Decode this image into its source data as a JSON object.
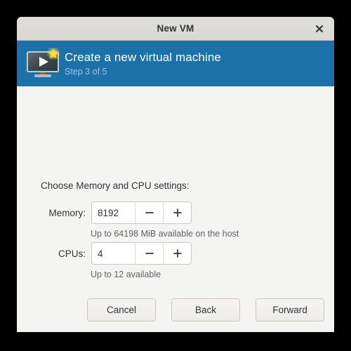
{
  "window": {
    "title": "New VM",
    "close_icon": "close-icon"
  },
  "header": {
    "icon": "new-virtual-machine-icon",
    "title": "Create a new virtual machine",
    "subtitle": "Step 3 of 5",
    "background_color": "#1c71a8",
    "title_color": "#ffffff",
    "subtitle_color": "#9dc4de"
  },
  "content": {
    "intro": "Choose Memory and CPU settings:",
    "fields": [
      {
        "label": "Memory:",
        "value": "8192",
        "decrement_icon": "minus-icon",
        "increment_icon": "plus-icon",
        "helper": "Up to 64198 MiB available on the host"
      },
      {
        "label": "CPUs:",
        "value": "4",
        "decrement_icon": "minus-icon",
        "increment_icon": "plus-icon",
        "helper": "Up to 12 available"
      }
    ]
  },
  "actions": {
    "cancel": "Cancel",
    "back": "Back",
    "forward": "Forward"
  }
}
